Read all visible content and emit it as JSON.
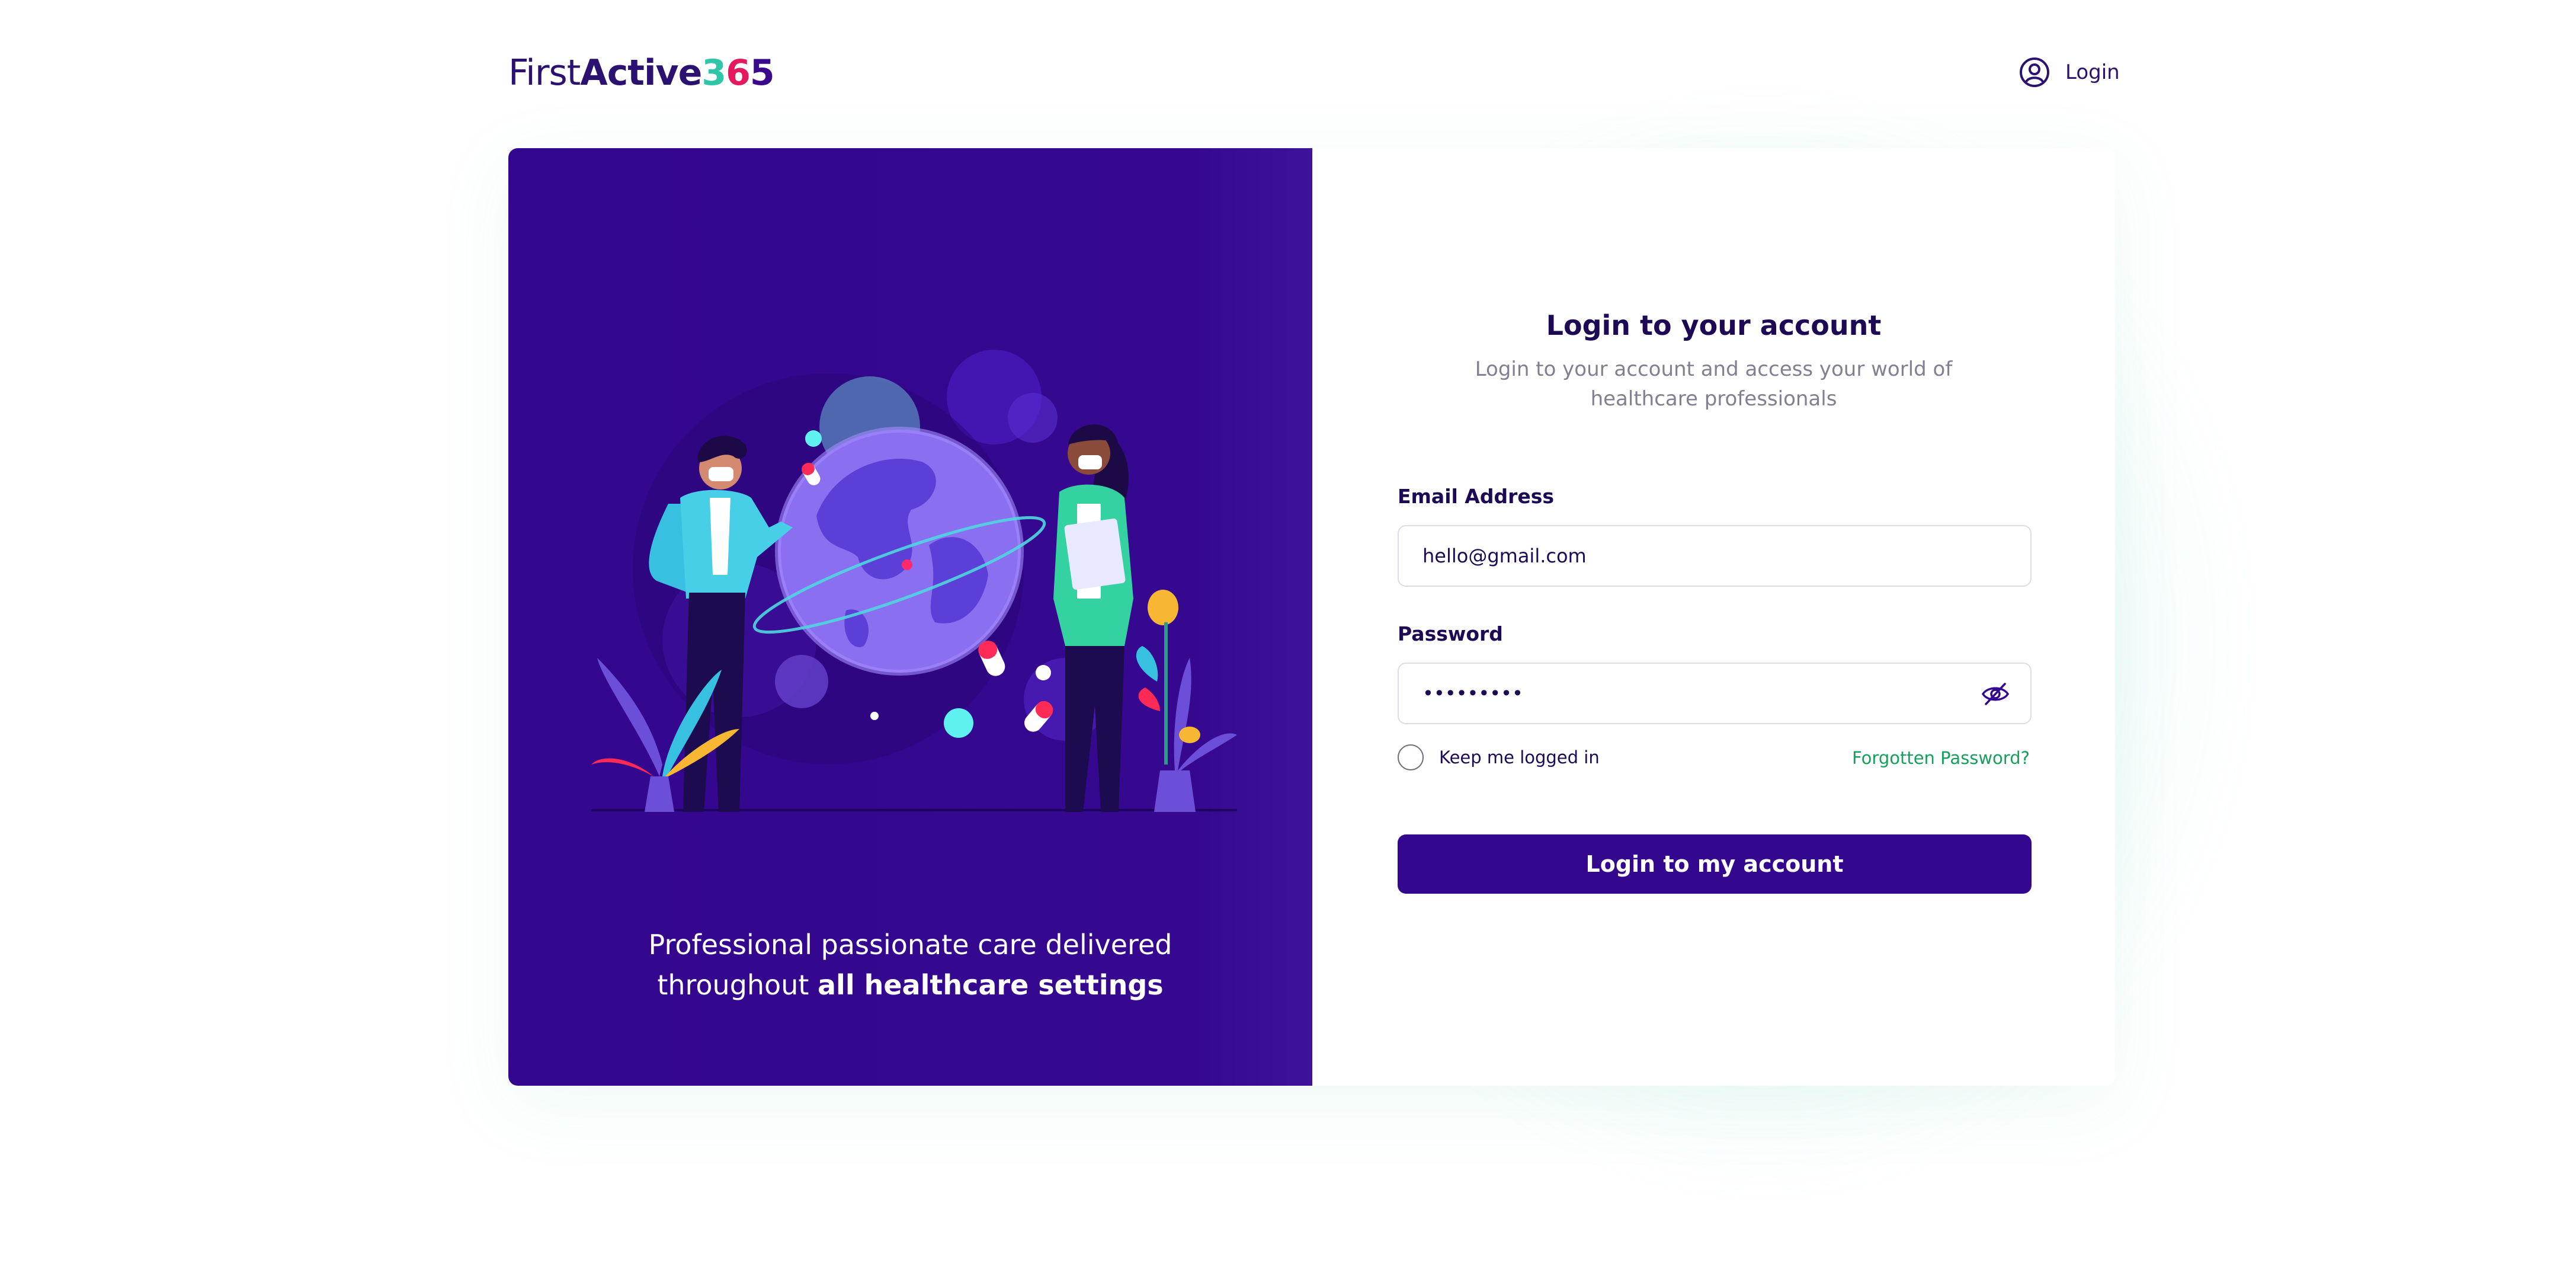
{
  "header": {
    "logo": {
      "part1": "First",
      "part2": "Active",
      "digit1": "3",
      "digit2": "6",
      "digit3": "5"
    },
    "login_label": "Login"
  },
  "hero": {
    "tagline_line1": "Professional passionate care delivered",
    "tagline_prefix": "throughout",
    "tagline_bold": "all healthcare settings"
  },
  "form": {
    "title": "Login to your account",
    "subtitle": "Login to your account and access your world of healthcare professionals",
    "email_label": "Email Address",
    "email_value": "hello@gmail.com",
    "password_label": "Password",
    "password_value": "•••••••••",
    "remember_label": "Keep me logged in",
    "forgot_label": "Forgotten Password?",
    "submit_label": "Login to my account"
  },
  "colors": {
    "brand_purple": "#33078e",
    "accent_teal": "#2fc6a8",
    "accent_pink": "#e5195e",
    "link_green": "#17a05d"
  },
  "icons": {
    "header_login": "user-circle-icon",
    "password_toggle": "eye-slash-icon"
  }
}
